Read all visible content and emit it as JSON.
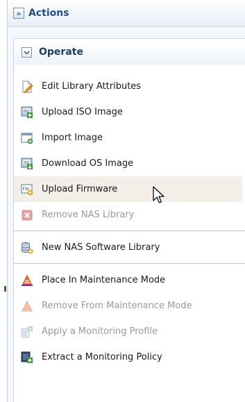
{
  "actions": {
    "title": "Actions",
    "expand_icon": "double-chevron-right-icon"
  },
  "operate": {
    "title": "Operate",
    "collapse_icon": "chevron-down-icon"
  },
  "menu": {
    "group1": [
      {
        "label": "Edit Library Attributes",
        "icon": "edit-document-icon",
        "enabled": true
      },
      {
        "label": "Upload ISO Image",
        "icon": "iso-upload-icon",
        "enabled": true
      },
      {
        "label": "Import Image",
        "icon": "import-image-icon",
        "enabled": true
      },
      {
        "label": "Download OS Image",
        "icon": "os-download-icon",
        "enabled": true
      },
      {
        "label": "Upload Firmware",
        "icon": "firmware-upload-icon",
        "enabled": true,
        "hovered": true
      },
      {
        "label": "Remove NAS Library",
        "icon": "remove-icon",
        "enabled": false
      }
    ],
    "group2": [
      {
        "label": "New NAS Software Library",
        "icon": "nas-library-icon",
        "enabled": true
      }
    ],
    "group3": [
      {
        "label": "Place In Maintenance Mode",
        "icon": "maintenance-cone-icon",
        "enabled": true
      },
      {
        "label": "Remove From Maintenance Mode",
        "icon": "maintenance-remove-icon",
        "enabled": false
      },
      {
        "label": "Apply a Monitoring Profile",
        "icon": "monitoring-profile-icon",
        "enabled": false
      },
      {
        "label": "Extract a Monitoring Policy",
        "icon": "monitoring-policy-icon",
        "enabled": true
      }
    ]
  },
  "colors": {
    "header_text": "#1f4f8a",
    "disabled_text": "#9a9a9a",
    "hover_bg": "#f1efe7"
  }
}
